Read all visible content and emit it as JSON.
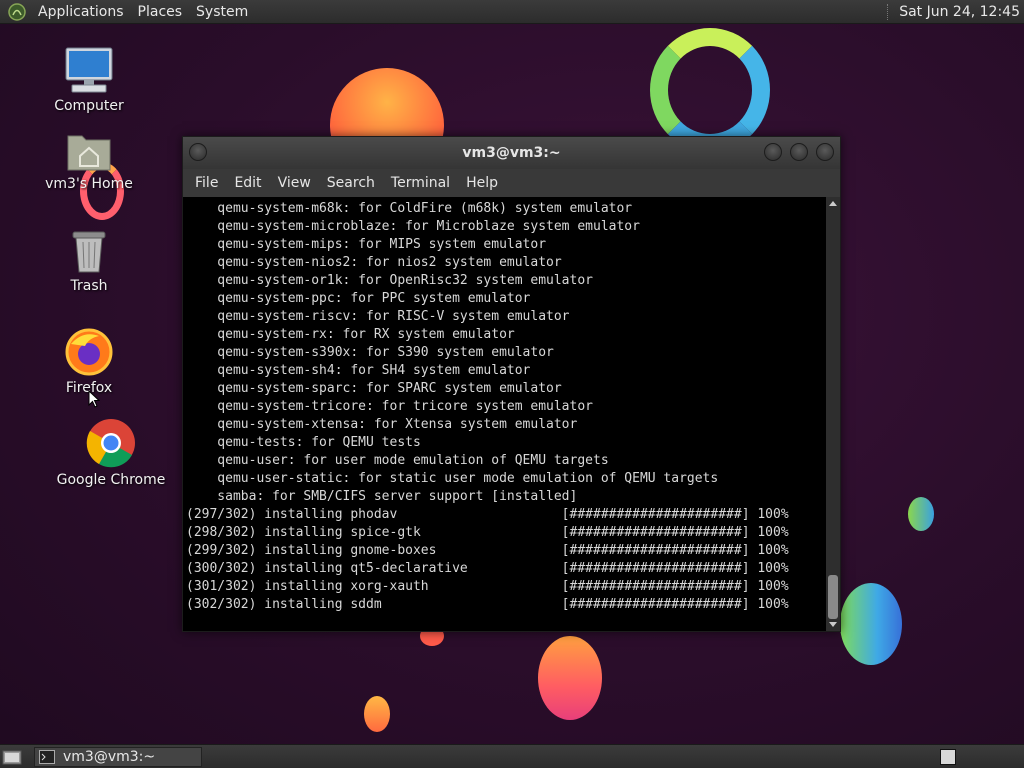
{
  "top_panel": {
    "menu": [
      "Applications",
      "Places",
      "System"
    ],
    "clock": "Sat Jun 24, 12:45"
  },
  "desktop_icons": {
    "computer": "Computer",
    "home": "vm3's Home",
    "trash": "Trash",
    "firefox": "Firefox",
    "chrome": "Google Chrome"
  },
  "window": {
    "title": "vm3@vm3:~",
    "menu": [
      "File",
      "Edit",
      "View",
      "Search",
      "Terminal",
      "Help"
    ]
  },
  "terminal_lines": [
    "    qemu-system-m68k: for ColdFire (m68k) system emulator",
    "    qemu-system-microblaze: for Microblaze system emulator",
    "    qemu-system-mips: for MIPS system emulator",
    "    qemu-system-nios2: for nios2 system emulator",
    "    qemu-system-or1k: for OpenRisc32 system emulator",
    "    qemu-system-ppc: for PPC system emulator",
    "    qemu-system-riscv: for RISC-V system emulator",
    "    qemu-system-rx: for RX system emulator",
    "    qemu-system-s390x: for S390 system emulator",
    "    qemu-system-sh4: for SH4 system emulator",
    "    qemu-system-sparc: for SPARC system emulator",
    "    qemu-system-tricore: for tricore system emulator",
    "    qemu-system-xtensa: for Xtensa system emulator",
    "    qemu-tests: for QEMU tests",
    "    qemu-user: for user mode emulation of QEMU targets",
    "    qemu-user-static: for static user mode emulation of QEMU targets",
    "    samba: for SMB/CIFS server support [installed]",
    "(297/302) installing phodav                     [######################] 100%",
    "(298/302) installing spice-gtk                  [######################] 100%",
    "(299/302) installing gnome-boxes                [######################] 100%",
    "(300/302) installing qt5-declarative            [######################] 100%",
    "(301/302) installing xorg-xauth                 [######################] 100%",
    "(302/302) installing sddm                       [######################] 100%"
  ],
  "taskbar": {
    "task": "vm3@vm3:~"
  }
}
